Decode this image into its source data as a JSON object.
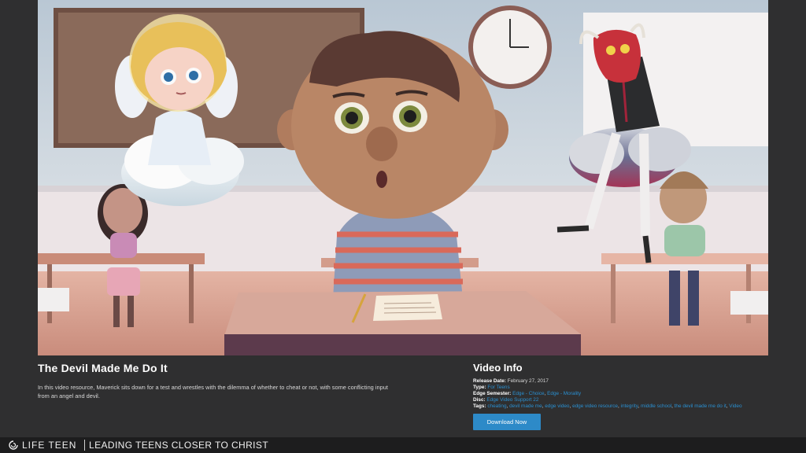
{
  "video": {
    "title": "The Devil Made Me Do It",
    "description": "In this video resource, Maverick sits down for a test and wrestles with the dilemma of whether to cheat or not, with some conflicting input from an angel and devil."
  },
  "info": {
    "heading": "Video Info",
    "release_label": "Release Date:",
    "release_value": "February 27, 2017",
    "type_label": "Type:",
    "type_value": "For Teens",
    "semester_label": "Edge Semester:",
    "semester_values": [
      "Edge - Choice",
      "Edge - Morality"
    ],
    "disc_label": "Disc:",
    "disc_value": "Edge Video Support 22",
    "tags_label": "Tags:",
    "tags": [
      "cheating",
      "devil made me",
      "edge video",
      "edge video resource",
      "integrity",
      "middle school",
      "the devil made me do it",
      "Video"
    ],
    "download_label": "Download Now"
  },
  "footer": {
    "brand": "LIFE TEEN",
    "tagline": "LEADING TEENS CLOSER TO CHRIST"
  },
  "colors": {
    "accent": "#2d8ac8",
    "link": "#2a8fd0",
    "background": "#2f2f30"
  },
  "icons": [
    "life-teen-logo-icon"
  ]
}
